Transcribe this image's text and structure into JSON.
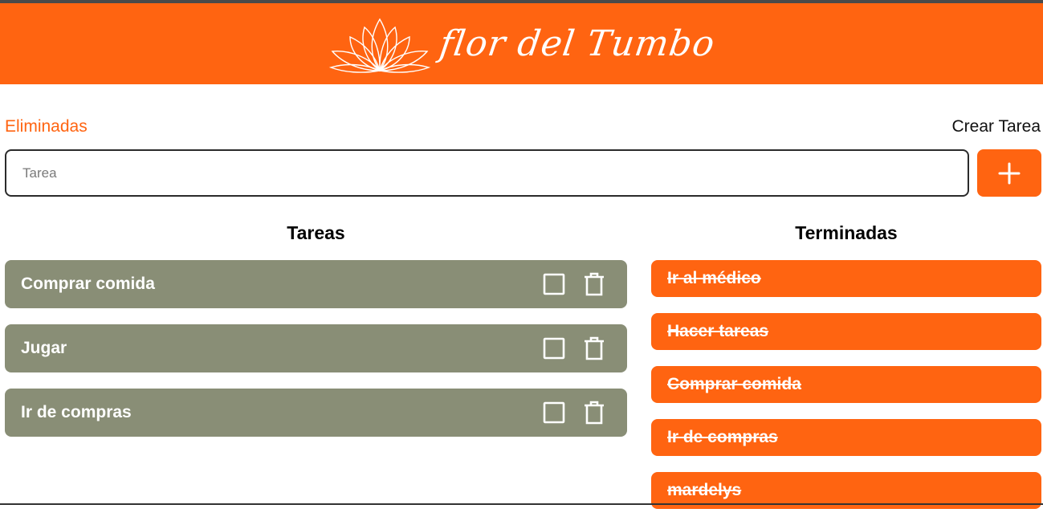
{
  "header": {
    "brand_name": "flor del Tumbo",
    "background_color": "#ff6411",
    "logo_icon": "lotus-icon"
  },
  "nav": {
    "deleted_link": "Eliminadas",
    "create_label": "Crear Tarea"
  },
  "form": {
    "input_value": "",
    "input_placeholder": "Tarea",
    "add_icon": "plus-icon"
  },
  "tasks": {
    "title": "Tareas",
    "items": [
      {
        "label": "Comprar comida"
      },
      {
        "label": "Jugar"
      },
      {
        "label": "Ir de compras"
      }
    ],
    "card_color": "#898e76"
  },
  "done": {
    "title": "Terminadas",
    "items": [
      {
        "label": "Ir al médico"
      },
      {
        "label": "Hacer tareas"
      },
      {
        "label": "Comprar comida"
      },
      {
        "label": "Ir de compras"
      },
      {
        "label": "mardelys"
      }
    ],
    "card_color": "#ff6411"
  }
}
